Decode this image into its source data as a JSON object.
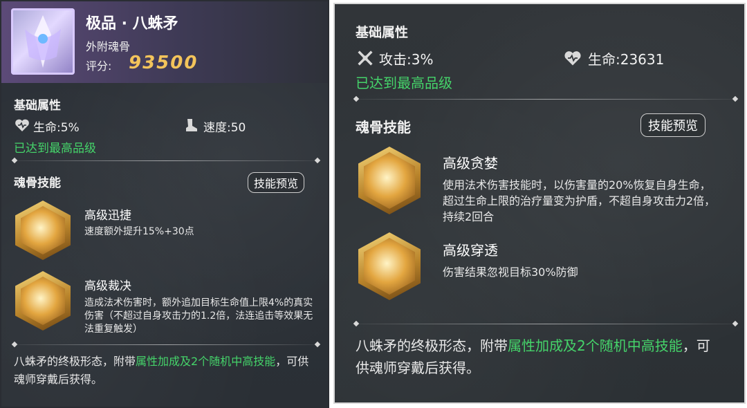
{
  "left": {
    "title": "极品 · 八蛛矛",
    "subtitle": "外附魂骨",
    "score_label": "评分:",
    "score_value": "93500",
    "base_attr_title": "基础属性",
    "stat1": "生命:5%",
    "stat2": "速度:50",
    "max_quality": "已达到最高品级",
    "skills_title": "魂骨技能",
    "preview_button": "技能预览",
    "skills": [
      {
        "name": "高级迅捷",
        "desc": "速度额外提升15%+30点"
      },
      {
        "name": "高级裁决",
        "desc": "造成法术伤害时，额外追加目标生命值上限4%的真实伤害（不超过自身攻击力的1.2倍，法连追击等效果无法重复触发）"
      }
    ],
    "footer_prefix": "八蛛矛的终极形态，附带",
    "footer_highlight": "属性加成及2个随机中高技能",
    "footer_suffix": "，可供魂师穿戴后获得。"
  },
  "right": {
    "base_attr_title": "基础属性",
    "stat1": "攻击:3%",
    "stat2": "生命:23631",
    "max_quality": "已达到最高品级",
    "skills_title": "魂骨技能",
    "preview_button": "技能预览",
    "skills": [
      {
        "name": "高级贪婪",
        "desc": "使用法术伤害技能时，以伤害量的20%恢复自身生命，超过生命上限的治疗量变为护盾，不超自身攻击力2倍，持续2回合"
      },
      {
        "name": "高级穿透",
        "desc": "伤害结果忽视目标30%防御"
      }
    ],
    "footer_prefix": "八蛛矛的终极形态，附带",
    "footer_highlight": "属性加成及2个随机中高技能",
    "footer_suffix": "，可供魂师穿戴后获得。"
  },
  "colors": {
    "green": "#45d46a",
    "score_gold": "#f3c45b"
  },
  "icons": [
    "item-emblem-icon",
    "heart-icon",
    "boot-icon",
    "sword-icon",
    "skill-hex-icon"
  ]
}
